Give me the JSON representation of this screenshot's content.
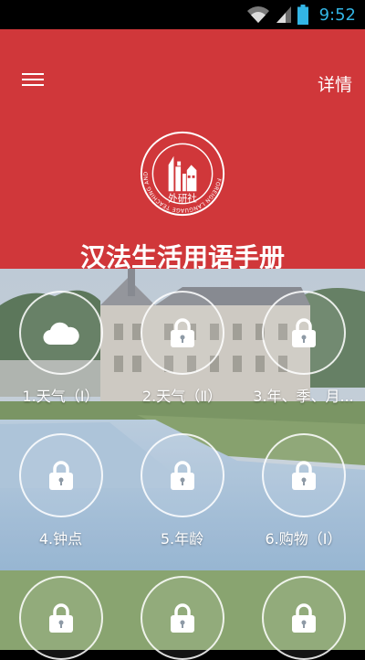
{
  "status": {
    "time": "9:52",
    "wifi_icon": "wifi-icon",
    "signal_icon": "signal-icon",
    "battery_icon": "battery-icon"
  },
  "header": {
    "menu_icon": "menu-icon",
    "detail_label": "详情",
    "book_title": "汉法生活用语手册",
    "logo_text": "外研社",
    "logo_ring_text": "FOREIGN LANGUAGE TEACHING AND RESEARCH PRESS",
    "color": "#d0373a"
  },
  "lessons": [
    {
      "label": "1.天气（Ⅰ）",
      "icon": "cloud-icon",
      "locked": false
    },
    {
      "label": "2.天气（Ⅱ）",
      "icon": "lock-icon",
      "locked": true
    },
    {
      "label": "3.年、季、月...",
      "icon": "lock-icon",
      "locked": true
    },
    {
      "label": "4.钟点",
      "icon": "lock-icon",
      "locked": true
    },
    {
      "label": "5.年龄",
      "icon": "lock-icon",
      "locked": true
    },
    {
      "label": "6.购物（Ⅰ）",
      "icon": "lock-icon",
      "locked": true
    },
    {
      "label": "",
      "icon": "lock-icon",
      "locked": true
    },
    {
      "label": "",
      "icon": "lock-icon",
      "locked": true
    },
    {
      "label": "",
      "icon": "lock-icon",
      "locked": true
    }
  ]
}
